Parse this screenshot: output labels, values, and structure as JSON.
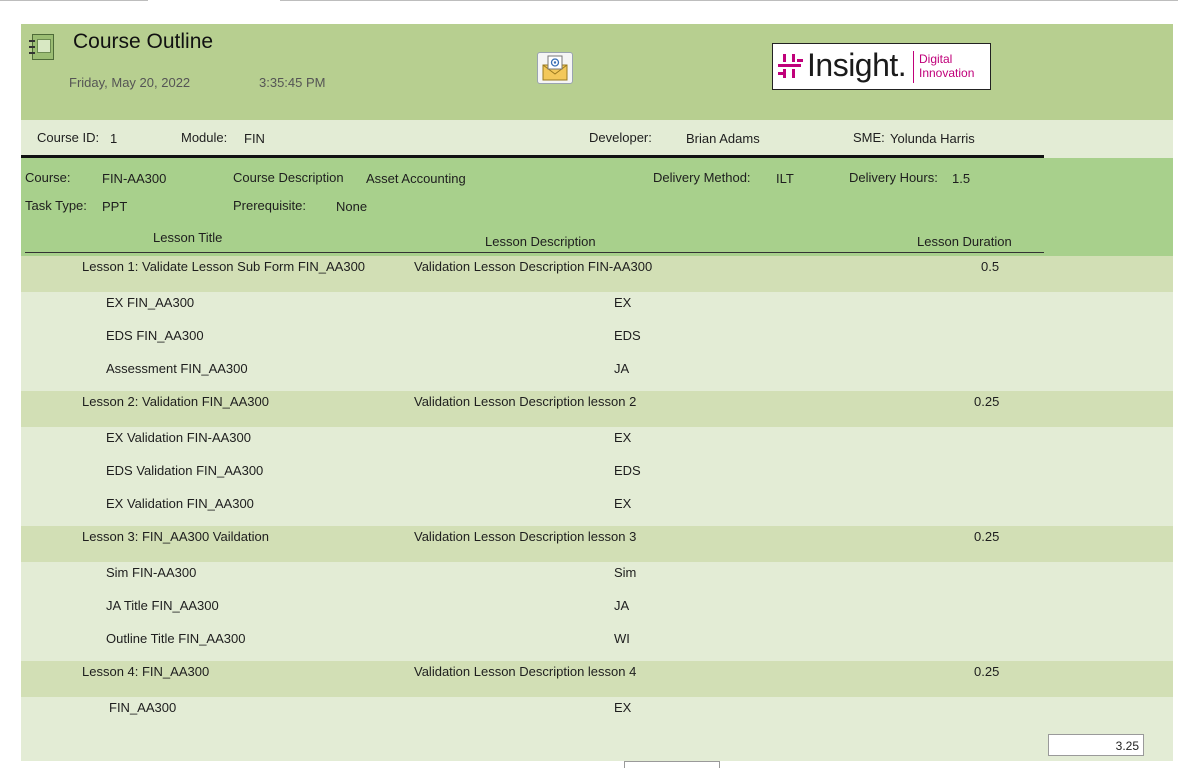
{
  "header": {
    "title": "Course Outline",
    "date": "Friday, May 20, 2022",
    "time": "3:35:45 PM",
    "logo": {
      "brand": "Insight.",
      "line1": "Digital",
      "line2": "Innovation"
    }
  },
  "course_info": {
    "course_id_label": "Course ID:",
    "course_id": "1",
    "module_label": "Module:",
    "module": "FIN",
    "developer_label": "Developer:",
    "developer": "Brian Adams",
    "sme_label": "SME:",
    "sme": "Yolunda Harris"
  },
  "details": {
    "course_label": "Course:",
    "course": "FIN-AA300",
    "course_desc_label": "Course Description",
    "course_desc": "Asset Accounting",
    "delivery_method_label": "Delivery Method:",
    "delivery_method": "ILT",
    "delivery_hours_label": "Delivery Hours:",
    "delivery_hours": "1.5",
    "task_type_label": "Task Type:",
    "task_type": "PPT",
    "prereq_label": "Prerequisite:",
    "prereq": "None"
  },
  "columns": {
    "title": "Lesson Title",
    "description": "Lesson Description",
    "duration": "Lesson Duration"
  },
  "lessons": [
    {
      "title": "Lesson 1: Validate Lesson Sub Form  FIN_AA300",
      "description": "Validation Lesson Description FIN-AA300",
      "duration": "0.5",
      "items": [
        {
          "name": "EX FIN_AA300",
          "type": "EX"
        },
        {
          "name": "EDS  FIN_AA300",
          "type": "EDS"
        },
        {
          "name": "Assessment FIN_AA300",
          "type": "JA"
        }
      ]
    },
    {
      "title": "Lesson 2: Validation  FIN_AA300",
      "description": "Validation Lesson Description lesson 2",
      "duration": "0.25",
      "items": [
        {
          "name": "EX Validation FIN-AA300",
          "type": "EX"
        },
        {
          "name": "EDS Validation  FIN_AA300",
          "type": "EDS"
        },
        {
          "name": "EX Validation  FIN_AA300",
          "type": "EX"
        }
      ]
    },
    {
      "title": "Lesson 3:  FIN_AA300 Vaildation",
      "description": "Validation Lesson Description lesson 3",
      "duration": "0.25",
      "items": [
        {
          "name": "Sim FIN-AA300",
          "type": "Sim"
        },
        {
          "name": "JA Title  FIN_AA300",
          "type": "JA"
        },
        {
          "name": "Outline Title  FIN_AA300",
          "type": "WI"
        }
      ]
    },
    {
      "title": "Lesson 4: FIN_AA300",
      "description": "Validation Lesson Description lesson 4",
      "duration": "0.25",
      "items": [
        {
          "name": "FIN_AA300",
          "type": "EX"
        }
      ]
    }
  ],
  "total_duration": "3.25"
}
